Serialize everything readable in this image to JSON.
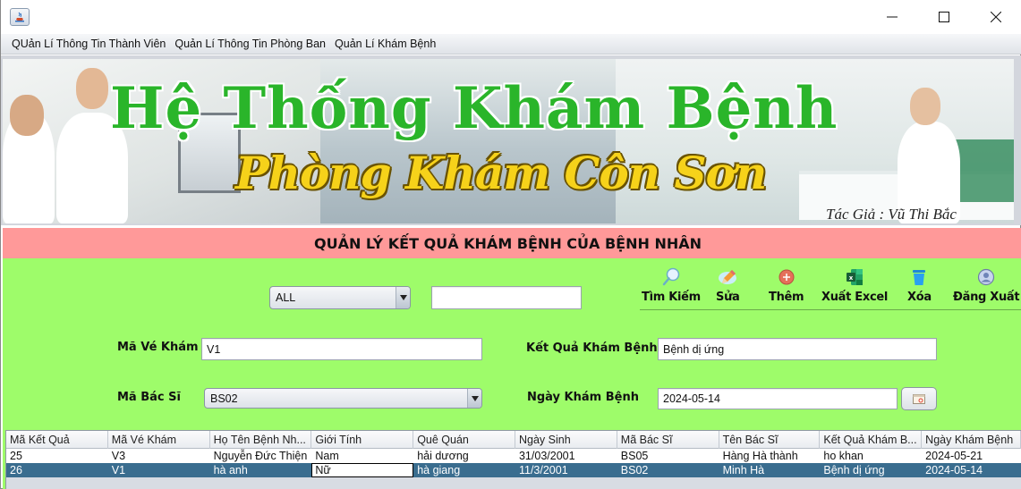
{
  "window": {
    "title": "",
    "controls": {
      "minimize": "minimize",
      "maximize": "maximize",
      "close": "close"
    }
  },
  "menu": {
    "items": [
      {
        "label": "QUản Lí Thông Tin Thành Viên"
      },
      {
        "label": "Quản Lí Thông Tin Phòng Ban"
      },
      {
        "label": "Quản Lí Khám Bệnh"
      }
    ]
  },
  "banner": {
    "title": "Hệ Thống Khám Bệnh",
    "subtitle": "Phòng Khám Côn Sơn",
    "author": "Tác Giả : Vũ Thi Bắc"
  },
  "section": {
    "title": "QUẢN LÝ KẾT QUẢ KHÁM BỆNH CỦA BỆNH NHÂN"
  },
  "filter": {
    "combo_value": "ALL",
    "search_value": ""
  },
  "toolbar": {
    "search_label": "Tìm Kiếm",
    "edit_label": "Sửa",
    "add_label": "Thêm",
    "excel_label": "Xuất Excel",
    "delete_label": "Xóa",
    "logout_label": "Đăng Xuất"
  },
  "form": {
    "ma_ve_kham_label": "Mã Vé Khám",
    "ma_ve_kham_value": "V1",
    "ma_bac_si_label": "Mã Bác Sĩ",
    "ma_bac_si_value": "BS02",
    "ket_qua_label": "Kết Quả Khám Bệnh",
    "ket_qua_value": "Bệnh dị ứng",
    "ngay_kham_label": "Ngày Khám Bệnh",
    "ngay_kham_value": "2024-05-14"
  },
  "table": {
    "columns": [
      "Mã Kết Quả",
      "Mã Vé Khám",
      "Họ Tên Bệnh Nh...",
      "Giới Tính",
      "Quê Quán",
      "Ngày Sinh",
      "Mã Bác Sĩ",
      "Tên Bác Sĩ",
      "Kết Quả Khám B...",
      "Ngày Khám Bệnh"
    ],
    "rows": [
      [
        "25",
        "V3",
        "Nguyễn Đức Thiện",
        "Nam",
        "hải dương",
        "31/03/2001",
        "BS05",
        "Hàng Hà thành",
        "ho khan",
        "2024-05-21"
      ],
      [
        "26",
        "V1",
        "hà anh",
        "Nữ",
        "hà giang",
        "11/3/2001",
        "BS02",
        "Minh Hà",
        "Bệnh dị ứng",
        "2024-05-14"
      ]
    ],
    "selected_row": 1
  },
  "colors": {
    "header_strip": "#ff9999",
    "panel_bg": "#9efc6a",
    "selected_row": "#3a6d8f",
    "title_green": "#2ab52a",
    "subtitle_yellow": "#f6d21a"
  }
}
